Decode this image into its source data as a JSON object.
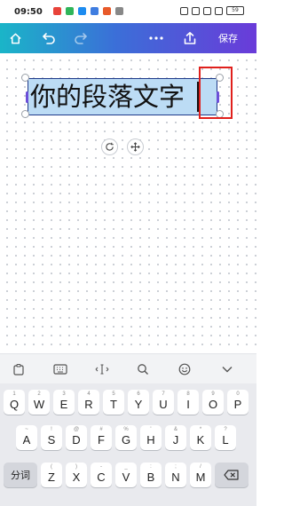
{
  "status_bar": {
    "time": "09:50",
    "battery": "59"
  },
  "toolbar": {
    "home_icon": "home-icon",
    "undo_icon": "undo-icon",
    "redo_icon": "redo-icon",
    "more_icon": "more-dots-icon",
    "share_icon": "share-upload-icon",
    "save_label": "保存",
    "accent_from": "#1ab5c8",
    "accent_to": "#6a3bd9"
  },
  "canvas": {
    "text_element": "你的段落文字",
    "selection_color": "#bcdcf5",
    "highlight_color": "#e0201c",
    "rotate_icon": "rotate-icon",
    "move_icon": "move-icon"
  },
  "keyboard_toolbar": {
    "tools": [
      "clipboard-icon",
      "keyboard-icon",
      "cursor-icon",
      "search-icon",
      "emoji-icon",
      "chevron-down-icon"
    ]
  },
  "keyboard": {
    "row1": [
      {
        "key": "Q",
        "hint": "1"
      },
      {
        "key": "W",
        "hint": "2"
      },
      {
        "key": "E",
        "hint": "3"
      },
      {
        "key": "R",
        "hint": "4"
      },
      {
        "key": "T",
        "hint": "5"
      },
      {
        "key": "Y",
        "hint": "6"
      },
      {
        "key": "U",
        "hint": "7"
      },
      {
        "key": "I",
        "hint": "8"
      },
      {
        "key": "O",
        "hint": "9"
      },
      {
        "key": "P",
        "hint": "0"
      }
    ],
    "row2": [
      {
        "key": "A",
        "hint": "~"
      },
      {
        "key": "S",
        "hint": "!"
      },
      {
        "key": "D",
        "hint": "@"
      },
      {
        "key": "F",
        "hint": "#"
      },
      {
        "key": "G",
        "hint": "%"
      },
      {
        "key": "H",
        "hint": "'"
      },
      {
        "key": "J",
        "hint": "&"
      },
      {
        "key": "K",
        "hint": "*"
      },
      {
        "key": "L",
        "hint": "?"
      }
    ],
    "row3": [
      {
        "key": "Z",
        "hint": "("
      },
      {
        "key": "X",
        "hint": ")"
      },
      {
        "key": "C",
        "hint": "-"
      },
      {
        "key": "V",
        "hint": "_"
      },
      {
        "key": "B",
        "hint": ":"
      },
      {
        "key": "N",
        "hint": ";"
      },
      {
        "key": "M",
        "hint": "/"
      }
    ],
    "segment_label": "分词",
    "backspace_icon": "backspace-icon"
  }
}
